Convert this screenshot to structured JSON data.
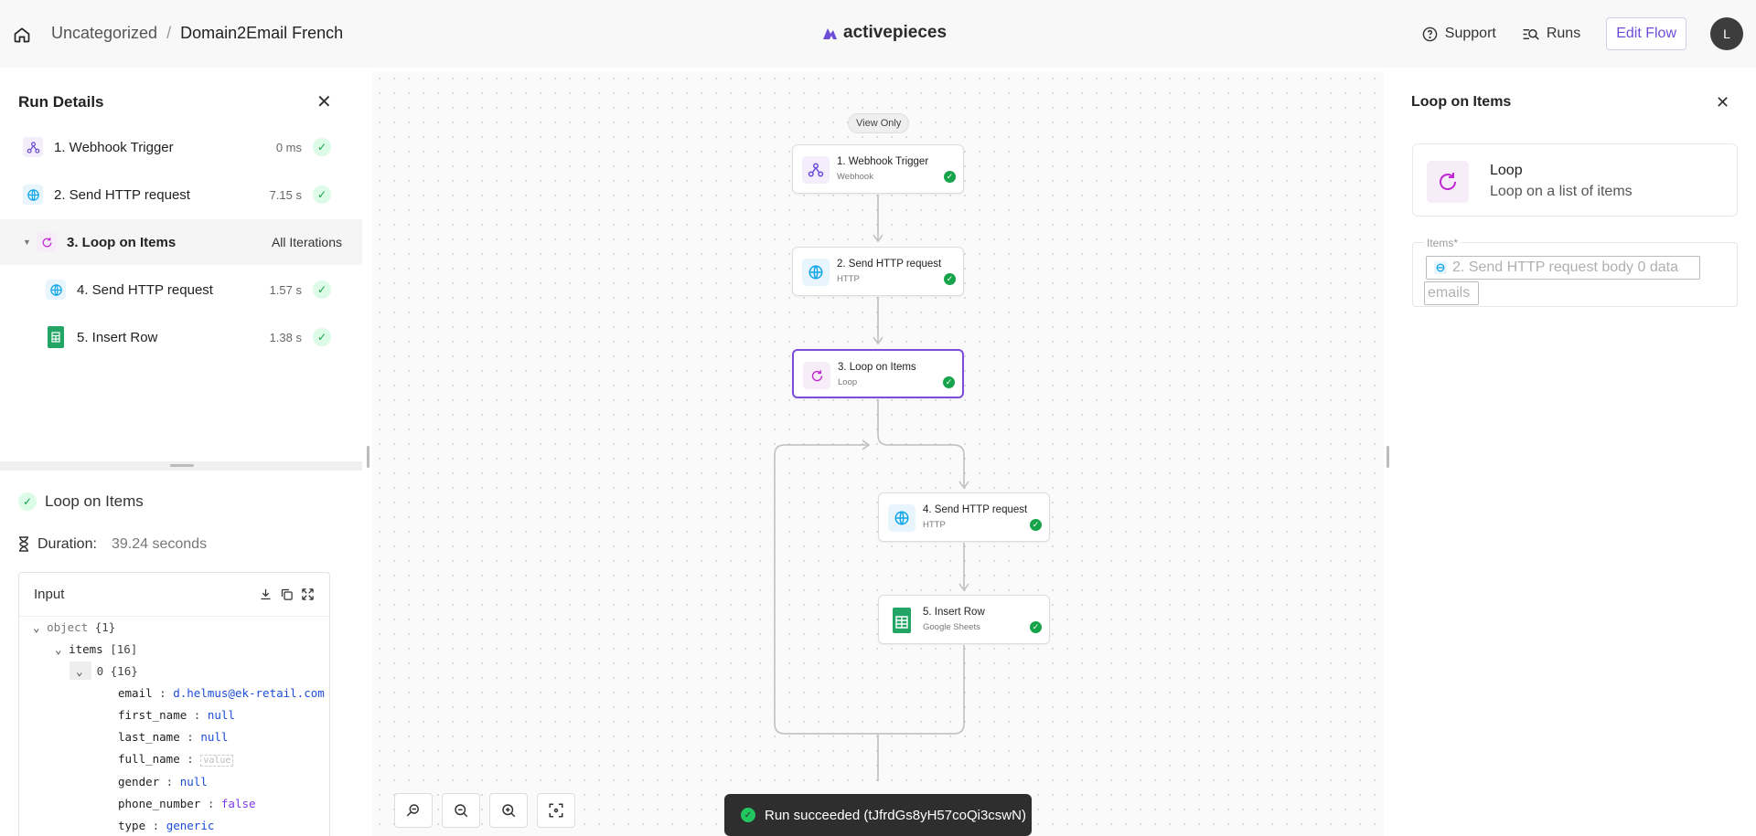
{
  "header": {
    "breadcrumb_folder": "Uncategorized",
    "breadcrumb_sep": "/",
    "breadcrumb_flow": "Domain2Email French",
    "brand": "activepieces",
    "support_label": "Support",
    "runs_label": "Runs",
    "edit_flow_label": "Edit Flow",
    "avatar_initial": "L"
  },
  "run_details": {
    "title": "Run Details",
    "steps": [
      {
        "label": "1. Webhook Trigger",
        "duration": "0 ms",
        "icon": "webhook-icon"
      },
      {
        "label": "2. Send HTTP request",
        "duration": "7.15 s",
        "icon": "globe-icon"
      },
      {
        "label": "3. Loop on Items",
        "duration": "All Iterations",
        "icon": "loop-icon"
      },
      {
        "label": "4. Send HTTP request",
        "duration": "1.57 s",
        "icon": "globe-icon"
      },
      {
        "label": "5. Insert Row",
        "duration": "1.38 s",
        "icon": "google-sheets-icon"
      }
    ]
  },
  "step_detail": {
    "name": "Loop on Items",
    "duration_label": "Duration:",
    "duration_value": "39.24 seconds",
    "input_label": "Input",
    "json": {
      "root": "object",
      "root_count": "{1}",
      "items_key": "items",
      "items_count": "[16]",
      "index": "0",
      "index_count": "{16}",
      "fields": [
        {
          "key": "email",
          "value": "d.helmus@ek-retail.com",
          "type": "str"
        },
        {
          "key": "first_name",
          "value": "null",
          "type": "nul"
        },
        {
          "key": "last_name",
          "value": "null",
          "type": "nul"
        },
        {
          "key": "full_name",
          "value": "value",
          "type": "empty"
        },
        {
          "key": "gender",
          "value": "null",
          "type": "nul"
        },
        {
          "key": "phone_number",
          "value": "false",
          "type": "bool"
        },
        {
          "key": "type",
          "value": "generic",
          "type": "str"
        }
      ]
    }
  },
  "canvas": {
    "view_only": "View Only",
    "nodes": [
      {
        "title": "1. Webhook Trigger",
        "sub": "Webhook"
      },
      {
        "title": "2. Send HTTP request",
        "sub": "HTTP"
      },
      {
        "title": "3. Loop on Items",
        "sub": "Loop"
      },
      {
        "title": "4. Send HTTP request",
        "sub": "HTTP"
      },
      {
        "title": "5. Insert Row",
        "sub": "Google Sheets"
      }
    ],
    "toast": "Run succeeded (tJfrdGs8yH57coQi3cswN)"
  },
  "right_panel": {
    "title": "Loop on Items",
    "piece_name": "Loop",
    "piece_desc": "Loop on a list of items",
    "items_label": "Items*",
    "items_chip_text": "2. Send HTTP request body 0 data",
    "items_chip_text2": "emails"
  },
  "colors": {
    "accent": "#7c4ddb",
    "success": "#16a34a",
    "toast_bg": "#2e2e2e"
  }
}
